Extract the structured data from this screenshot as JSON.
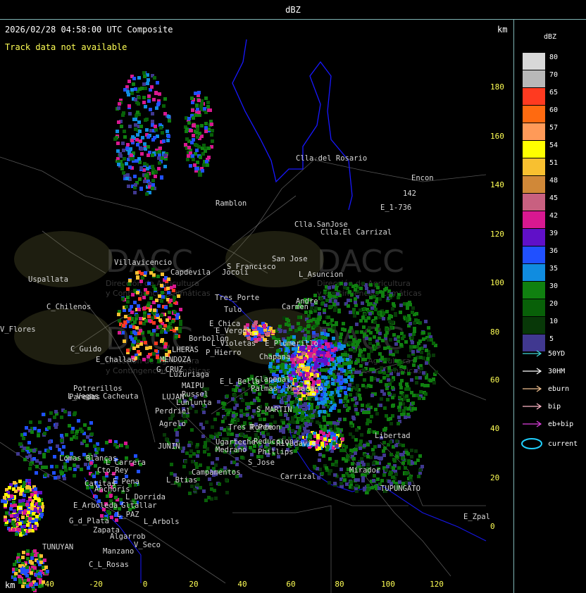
{
  "window": {
    "title": "dBZ"
  },
  "header": {
    "timestamp": "2026/02/28 04:58:00 UTC Composite",
    "track_status": "Track data not available",
    "unit_km_top": "km",
    "unit_km_bottom": "km"
  },
  "axes": {
    "y_ticks": [
      "180",
      "160",
      "140",
      "120",
      "100",
      "80",
      "60",
      "40",
      "20",
      "0"
    ],
    "x_ticks": [
      "-40",
      "-20",
      "0",
      "20",
      "40",
      "60",
      "80",
      "100",
      "120"
    ]
  },
  "watermark": {
    "brand": "DACC",
    "line1": "Dirección de Agricultura",
    "line2": "y Contingencias Climáticas"
  },
  "places": [
    "Clla.del Rosario",
    "Encon",
    "142",
    "E_1-736",
    "Ramblon",
    "Clla.SanJose",
    "Clla.El Carrizal",
    "S_Francisco",
    "San Jose",
    "L_Asuncion",
    "Villavicencio",
    "Uspallata",
    "Capdevila",
    "Jocoli",
    "C_Chilenos",
    "Tres_Porte",
    "Tulo",
    "Carmen",
    "Andre",
    "E_Chica",
    "E_Vergel",
    "Borbollon",
    "L_Violetas",
    "E_Plumerillo",
    "P_Hierro",
    "Chapana",
    "LHERAS",
    "C_Guido",
    "E_Challao",
    "MENDOZA",
    "G_CRUZ",
    "Luzuriaga",
    "E_L_Bella",
    "Palmas",
    "Clapenal",
    "M_Cacaro",
    "Potrerillos",
    "MAIPU",
    "Russel",
    "Cacheuta",
    "L_Vegas",
    "LUJAN",
    "Lunlunta",
    "Perdriel",
    "S_MARTIN",
    "Agrelo",
    "Tres_Porte",
    "R_Penon",
    "JUNIN",
    "Ugarteche",
    "Medrano",
    "Reduccion",
    "Rivadavia",
    "Phillips",
    "Libertad",
    "Lomas Blancas",
    "L_Carrera",
    "Cto_Rey",
    "S_Jose",
    "Campamentos",
    "Carrizal",
    "Mirador",
    "Catitas",
    "E_Pena",
    "L_Btias",
    "Anchoris",
    "TUPUNGATO",
    "L_Dorrida",
    "E_Arboleda",
    "Gltallar",
    "E_Zpal",
    "L_PAZ",
    "G_d_Plata",
    "L_Arbols",
    "Zapata",
    "Algarrob",
    "V_Seco",
    "TUNUYAN",
    "Manzano",
    "C_L_Rosas",
    "V_Flores",
    "Paredas",
    "V_Vegas"
  ],
  "legend": {
    "title": "dBZ",
    "levels": [
      {
        "label": "80",
        "color": "#d8d8d8"
      },
      {
        "label": "70",
        "color": "#b8b8b8"
      },
      {
        "label": "65",
        "color": "#ff3a20"
      },
      {
        "label": "60",
        "color": "#ff6a10"
      },
      {
        "label": "57",
        "color": "#ff9a58"
      },
      {
        "label": "54",
        "color": "#ffff00"
      },
      {
        "label": "51",
        "color": "#f8c030"
      },
      {
        "label": "48",
        "color": "#d08838"
      },
      {
        "label": "45",
        "color": "#c86080"
      },
      {
        "label": "42",
        "color": "#d81890"
      },
      {
        "label": "39",
        "color": "#6010c8"
      },
      {
        "label": "36",
        "color": "#2050ff"
      },
      {
        "label": "35",
        "color": "#108ce0"
      },
      {
        "label": "30",
        "color": "#108010"
      },
      {
        "label": "20",
        "color": "#086008"
      },
      {
        "label": "10",
        "color": "#083808"
      },
      {
        "label": "5",
        "color": "#403890"
      }
    ]
  },
  "track_legend": [
    {
      "label": "50YD",
      "color": "#40d8d8"
    },
    {
      "label": "30HM",
      "color": "#ffffff"
    },
    {
      "label": "eburn",
      "color": "#f0c090"
    },
    {
      "label": "bip",
      "color": "#ffb8c8"
    },
    {
      "label": "eb+bip",
      "color": "#e040e0"
    },
    {
      "label": "current",
      "color": "#20d0ff"
    }
  ],
  "colors": {
    "border": "#7fb5b5",
    "axis_text": "#ffff55",
    "province_line": "#1818ff",
    "road": "#9a9a9a"
  }
}
